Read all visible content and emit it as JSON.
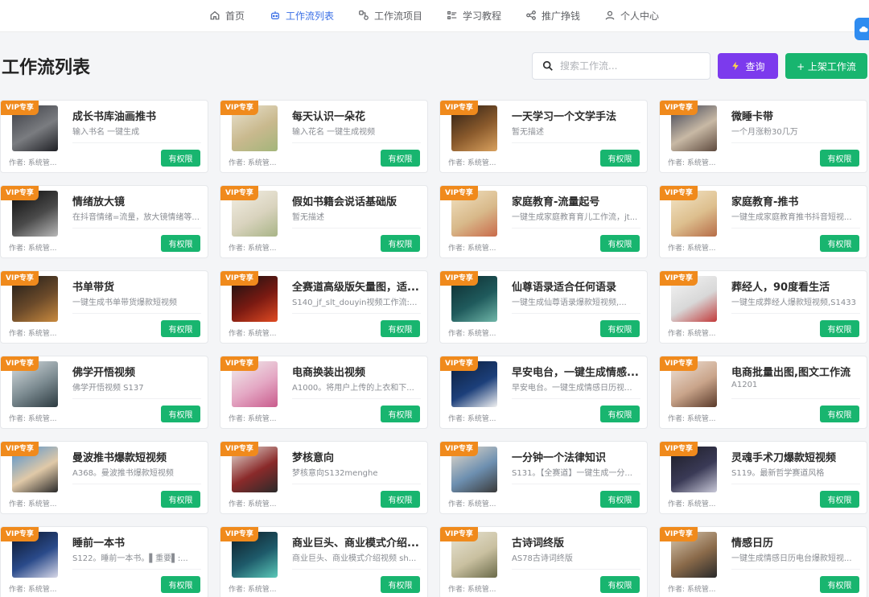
{
  "nav": {
    "items": [
      {
        "label": "首页",
        "icon": "home-icon",
        "active": false
      },
      {
        "label": "工作流列表",
        "icon": "robot-icon",
        "active": true
      },
      {
        "label": "工作流项目",
        "icon": "nodes-icon",
        "active": false
      },
      {
        "label": "学习教程",
        "icon": "list-icon",
        "active": false
      },
      {
        "label": "推广挣钱",
        "icon": "share-icon",
        "active": false
      },
      {
        "label": "个人中心",
        "icon": "user-icon",
        "active": false
      }
    ]
  },
  "page": {
    "title": "工作流列表",
    "search_placeholder": "搜索工作流...",
    "query_label": "查询",
    "publish_label": "+ 上架工作流"
  },
  "colors": {
    "accent": "#3a6fe6",
    "vip": "#f08a1c",
    "green": "#18b56f",
    "purple": "#7c3aed"
  },
  "cards": [
    {
      "vip": "VIP专享",
      "title": "成长书库油画推书",
      "desc": "输入书名 一键生成",
      "author": "作者: 系统管...",
      "btn": "有权限",
      "thumb": [
        "#3b3d44",
        "#7a7c80",
        "#1f2025"
      ]
    },
    {
      "vip": "VIP专享",
      "title": "每天认识一朵花",
      "desc": "输入花名 一键生成视频",
      "author": "作者: 系统管...",
      "btn": "有权限",
      "thumb": [
        "#e9e2cf",
        "#c9b98e",
        "#a3b57a"
      ]
    },
    {
      "vip": "VIP专享",
      "title": "一天学习一个文学手法",
      "desc": "暂无描述",
      "author": "作者: 系统管...",
      "btn": "有权限",
      "thumb": [
        "#2a1d14",
        "#8a5a2c",
        "#d9a15e"
      ]
    },
    {
      "vip": "VIP专享",
      "title": "微睡卡带",
      "desc": "一个月涨粉30几万",
      "author": "作者: 系统管...",
      "btn": "有权限",
      "thumb": [
        "#3a3f52",
        "#c8b9a5",
        "#5e4a3e"
      ]
    },
    {
      "vip": "VIP专享",
      "title": "情绪放大镜",
      "desc": "在抖音情绪=流量，放大镜情绪等...",
      "author": "作者: 系统管...",
      "btn": "有权限",
      "thumb": [
        "#0a0a0a",
        "#4a4a4a",
        "#b8b8b8"
      ]
    },
    {
      "vip": "VIP专享",
      "title": "假如书籍会说话基础版",
      "desc": "暂无描述",
      "author": "作者: 系统管...",
      "btn": "有权限",
      "thumb": [
        "#f3efe4",
        "#d9d3be",
        "#a8b486"
      ]
    },
    {
      "vip": "VIP专享",
      "title": "家庭教育-流量起号",
      "desc": "一键生成家庭教育育儿工作流，jt...",
      "author": "作者: 系统管...",
      "btn": "有权限",
      "thumb": [
        "#f2e2c2",
        "#d8b98a",
        "#c96a4a"
      ]
    },
    {
      "vip": "VIP专享",
      "title": "家庭教育-推书",
      "desc": "一键生成家庭教育推书抖音短视...",
      "author": "作者: 系统管...",
      "btn": "有权限",
      "thumb": [
        "#f4e6c8",
        "#ddbf8e",
        "#b66c47"
      ]
    },
    {
      "vip": "VIP专享",
      "title": "书单带货",
      "desc": "一键生成书单带货爆款短视频",
      "author": "作者: 系统管...",
      "btn": "有权限",
      "thumb": [
        "#1c1a18",
        "#6b4a2a",
        "#c98a3e"
      ]
    },
    {
      "vip": "VIP专享",
      "title": "全赛道高级版矢量图，适...",
      "desc": "S140_jf_slt_douyin视频工作流:...",
      "author": "作者: 系统管...",
      "btn": "有权限",
      "thumb": [
        "#111111",
        "#7a1a12",
        "#e04a22"
      ]
    },
    {
      "vip": "VIP专享",
      "title": "仙尊语录适合任何语录",
      "desc": "一键生成仙尊语录爆款短视频,...",
      "author": "作者: 系统管...",
      "btn": "有权限",
      "thumb": [
        "#0d2a2e",
        "#1f5a5c",
        "#6fb6a8"
      ]
    },
    {
      "vip": "VIP专享",
      "title": "葬经人，90度看生活",
      "desc": "一键生成葬经人爆款短视频,S1433",
      "author": "作者: 系统管...",
      "btn": "有权限",
      "thumb": [
        "#f5f5f5",
        "#d8d8d8",
        "#c23a3a"
      ]
    },
    {
      "vip": "VIP专享",
      "title": "佛学开悟视频",
      "desc": "佛学开悟视频 S137",
      "author": "作者: 系统管...",
      "btn": "有权限",
      "thumb": [
        "#d9dfe2",
        "#7b8a90",
        "#2c3a40"
      ]
    },
    {
      "vip": "VIP专享",
      "title": "电商换装出视频",
      "desc": "A1000。将用户上传的上衣和下...",
      "author": "作者: 系统管...",
      "btn": "有权限",
      "thumb": [
        "#f1efed",
        "#e4a8c4",
        "#c95b8c"
      ]
    },
    {
      "vip": "VIP专享",
      "title": "早安电台，一键生成情感...",
      "desc": "早安电台。一键生成情感日历视...",
      "author": "作者: 系统管...",
      "btn": "有权限",
      "thumb": [
        "#0c1e3a",
        "#1c3f7a",
        "#f2f2f2"
      ]
    },
    {
      "vip": "VIP专享",
      "title": "电商批量出图,图文工作流",
      "desc": "A1201",
      "author": "作者: 系统管...",
      "btn": "有权限",
      "thumb": [
        "#f0e3d8",
        "#c9a48a",
        "#5a3a2a"
      ]
    },
    {
      "vip": "VIP专享",
      "title": "曼波推书爆款短视频",
      "desc": "A368。曼波推书爆款短视频",
      "author": "作者: 系统管...",
      "btn": "有权限",
      "thumb": [
        "#4b8fd0",
        "#e0c9a8",
        "#2a2a2a"
      ]
    },
    {
      "vip": "VIP专享",
      "title": "梦核意向",
      "desc": "梦核意向S132menghe",
      "author": "作者: 系统管...",
      "btn": "有权限",
      "thumb": [
        "#e7e2da",
        "#8a2a2a",
        "#2a2a2a"
      ]
    },
    {
      "vip": "VIP专享",
      "title": "一分钟一个法律知识",
      "desc": "S131。【全赛道】一键生成一分...",
      "author": "作者: 系统管...",
      "btn": "有权限",
      "thumb": [
        "#e8dccb",
        "#6d8fb0",
        "#3a3a3a"
      ]
    },
    {
      "vip": "VIP专享",
      "title": "灵魂手术刀爆款短视频",
      "desc": "S119。最新哲学赛道风格",
      "author": "作者: 系统管...",
      "btn": "有权限",
      "thumb": [
        "#1c1c24",
        "#3a3a56",
        "#c8c8d8"
      ]
    },
    {
      "vip": "VIP专享",
      "title": "睡前一本书",
      "desc": "S122。睡前一本书。▌重要▌:...",
      "author": "作者: 系统管...",
      "btn": "有权限",
      "thumb": [
        "#0a1428",
        "#2a4a8a",
        "#d8d8e8"
      ]
    },
    {
      "vip": "VIP专享",
      "title": "商业巨头、商业模式介绍...",
      "desc": "商业巨头、商业模式介绍视频 sh...",
      "author": "作者: 系统管...",
      "btn": "有权限",
      "thumb": [
        "#0e1a24",
        "#1e5a6a",
        "#5ac8b8"
      ]
    },
    {
      "vip": "VIP专享",
      "title": "古诗词终版",
      "desc": "AS78古诗词终版",
      "author": "作者: 系统管...",
      "btn": "有权限",
      "thumb": [
        "#e8e4d4",
        "#c9c0a0",
        "#6b6b4a"
      ]
    },
    {
      "vip": "VIP专享",
      "title": "情感日历",
      "desc": "一键生成情感日历电台爆款短视...",
      "author": "作者: 系统管...",
      "btn": "有权限",
      "thumb": [
        "#d8c8b0",
        "#8a6a4a",
        "#2a2a2a"
      ]
    }
  ]
}
